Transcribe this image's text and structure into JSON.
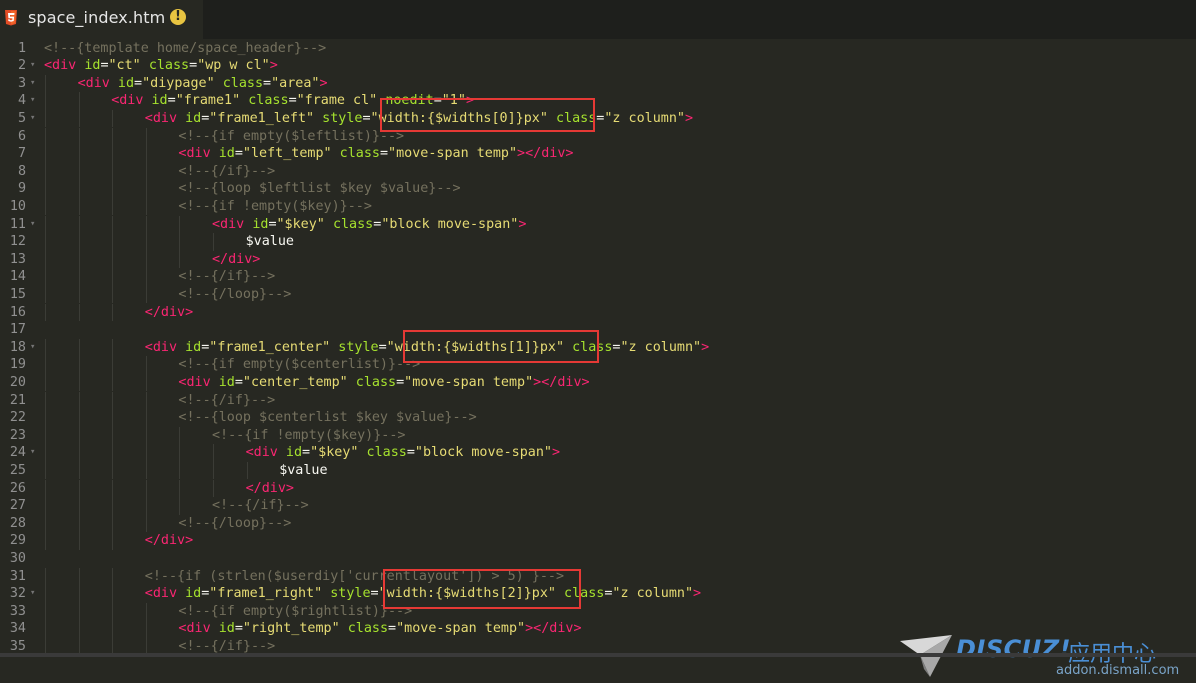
{
  "tab": {
    "title": "space_index.htm",
    "file_icon": "html5-icon",
    "status_icon": "warning-icon",
    "status_glyph": "!"
  },
  "lines": [
    {
      "n": "1",
      "fold": false,
      "ind": 0,
      "toks": [
        [
          "c",
          "<!--{template home/space_header}-->"
        ]
      ]
    },
    {
      "n": "2",
      "fold": true,
      "ind": 0,
      "toks": [
        [
          "t",
          "<div"
        ],
        [
          "p",
          " "
        ],
        [
          "a",
          "id"
        ],
        [
          "p",
          "="
        ],
        [
          "s",
          "\"ct\""
        ],
        [
          "p",
          " "
        ],
        [
          "a",
          "class"
        ],
        [
          "p",
          "="
        ],
        [
          "s",
          "\"wp w cl\""
        ],
        [
          "t",
          ">"
        ]
      ]
    },
    {
      "n": "3",
      "fold": true,
      "ind": 1,
      "toks": [
        [
          "t",
          "<div"
        ],
        [
          "p",
          " "
        ],
        [
          "a",
          "id"
        ],
        [
          "p",
          "="
        ],
        [
          "s",
          "\"diypage\""
        ],
        [
          "p",
          " "
        ],
        [
          "a",
          "class"
        ],
        [
          "p",
          "="
        ],
        [
          "s",
          "\"area\""
        ],
        [
          "t",
          ">"
        ]
      ]
    },
    {
      "n": "4",
      "fold": true,
      "ind": 2,
      "toks": [
        [
          "t",
          "<div"
        ],
        [
          "p",
          " "
        ],
        [
          "a",
          "id"
        ],
        [
          "p",
          "="
        ],
        [
          "s",
          "\"frame1\""
        ],
        [
          "p",
          " "
        ],
        [
          "a",
          "class"
        ],
        [
          "p",
          "="
        ],
        [
          "s",
          "\"frame cl\""
        ],
        [
          "p",
          " "
        ],
        [
          "a",
          "noedit"
        ],
        [
          "p",
          "="
        ],
        [
          "s",
          "\"1\""
        ],
        [
          "t",
          ">"
        ]
      ]
    },
    {
      "n": "5",
      "fold": true,
      "ind": 3,
      "toks": [
        [
          "t",
          "<div"
        ],
        [
          "p",
          " "
        ],
        [
          "a",
          "id"
        ],
        [
          "p",
          "="
        ],
        [
          "s",
          "\"frame1_left\""
        ],
        [
          "p",
          " "
        ],
        [
          "a",
          "style"
        ],
        [
          "p",
          "="
        ],
        [
          "s",
          "\"width:{$widths[0]}px\""
        ],
        [
          "p",
          " "
        ],
        [
          "a",
          "class"
        ],
        [
          "p",
          "="
        ],
        [
          "s",
          "\"z column\""
        ],
        [
          "t",
          ">"
        ]
      ]
    },
    {
      "n": "6",
      "fold": false,
      "ind": 4,
      "toks": [
        [
          "c",
          "<!--{if empty($leftlist)}-->"
        ]
      ]
    },
    {
      "n": "7",
      "fold": false,
      "ind": 4,
      "toks": [
        [
          "t",
          "<div"
        ],
        [
          "p",
          " "
        ],
        [
          "a",
          "id"
        ],
        [
          "p",
          "="
        ],
        [
          "s",
          "\"left_temp\""
        ],
        [
          "p",
          " "
        ],
        [
          "a",
          "class"
        ],
        [
          "p",
          "="
        ],
        [
          "s",
          "\"move-span temp\""
        ],
        [
          "t",
          "></div>"
        ]
      ]
    },
    {
      "n": "8",
      "fold": false,
      "ind": 4,
      "toks": [
        [
          "c",
          "<!--{/if}-->"
        ]
      ]
    },
    {
      "n": "9",
      "fold": false,
      "ind": 4,
      "toks": [
        [
          "c",
          "<!--{loop $leftlist $key $value}-->"
        ]
      ]
    },
    {
      "n": "10",
      "fold": false,
      "ind": 4,
      "toks": [
        [
          "c",
          "<!--{if !empty($key)}-->"
        ]
      ]
    },
    {
      "n": "11",
      "fold": true,
      "ind": 5,
      "toks": [
        [
          "t",
          "<div"
        ],
        [
          "p",
          " "
        ],
        [
          "a",
          "id"
        ],
        [
          "p",
          "="
        ],
        [
          "s",
          "\"$key\""
        ],
        [
          "p",
          " "
        ],
        [
          "a",
          "class"
        ],
        [
          "p",
          "="
        ],
        [
          "s",
          "\"block move-span\""
        ],
        [
          "t",
          ">"
        ]
      ]
    },
    {
      "n": "12",
      "fold": false,
      "ind": 6,
      "toks": [
        [
          "p",
          "$value"
        ]
      ]
    },
    {
      "n": "13",
      "fold": false,
      "ind": 5,
      "toks": [
        [
          "t",
          "</div>"
        ]
      ]
    },
    {
      "n": "14",
      "fold": false,
      "ind": 4,
      "toks": [
        [
          "c",
          "<!--{/if}-->"
        ]
      ]
    },
    {
      "n": "15",
      "fold": false,
      "ind": 4,
      "toks": [
        [
          "c",
          "<!--{/loop}-->"
        ]
      ]
    },
    {
      "n": "16",
      "fold": false,
      "ind": 3,
      "toks": [
        [
          "t",
          "</div>"
        ]
      ]
    },
    {
      "n": "17",
      "fold": false,
      "ind": 0,
      "toks": []
    },
    {
      "n": "18",
      "fold": true,
      "ind": 3,
      "toks": [
        [
          "t",
          "<div"
        ],
        [
          "p",
          " "
        ],
        [
          "a",
          "id"
        ],
        [
          "p",
          "="
        ],
        [
          "s",
          "\"frame1_center\""
        ],
        [
          "p",
          " "
        ],
        [
          "a",
          "style"
        ],
        [
          "p",
          "="
        ],
        [
          "s",
          "\"width:{$widths[1]}px\""
        ],
        [
          "p",
          " "
        ],
        [
          "a",
          "class"
        ],
        [
          "p",
          "="
        ],
        [
          "s",
          "\"z column\""
        ],
        [
          "t",
          ">"
        ]
      ]
    },
    {
      "n": "19",
      "fold": false,
      "ind": 4,
      "toks": [
        [
          "c",
          "<!--{if empty($centerlist)}-->"
        ]
      ]
    },
    {
      "n": "20",
      "fold": false,
      "ind": 4,
      "toks": [
        [
          "t",
          "<div"
        ],
        [
          "p",
          " "
        ],
        [
          "a",
          "id"
        ],
        [
          "p",
          "="
        ],
        [
          "s",
          "\"center_temp\""
        ],
        [
          "p",
          " "
        ],
        [
          "a",
          "class"
        ],
        [
          "p",
          "="
        ],
        [
          "s",
          "\"move-span temp\""
        ],
        [
          "t",
          "></div>"
        ]
      ]
    },
    {
      "n": "21",
      "fold": false,
      "ind": 4,
      "toks": [
        [
          "c",
          "<!--{/if}-->"
        ]
      ]
    },
    {
      "n": "22",
      "fold": false,
      "ind": 4,
      "toks": [
        [
          "c",
          "<!--{loop $centerlist $key $value}-->"
        ]
      ]
    },
    {
      "n": "23",
      "fold": false,
      "ind": 5,
      "toks": [
        [
          "c",
          "<!--{if !empty($key)}-->"
        ]
      ]
    },
    {
      "n": "24",
      "fold": true,
      "ind": 6,
      "toks": [
        [
          "t",
          "<div"
        ],
        [
          "p",
          " "
        ],
        [
          "a",
          "id"
        ],
        [
          "p",
          "="
        ],
        [
          "s",
          "\"$key\""
        ],
        [
          "p",
          " "
        ],
        [
          "a",
          "class"
        ],
        [
          "p",
          "="
        ],
        [
          "s",
          "\"block move-span\""
        ],
        [
          "t",
          ">"
        ]
      ]
    },
    {
      "n": "25",
      "fold": false,
      "ind": 7,
      "toks": [
        [
          "p",
          "$value"
        ]
      ]
    },
    {
      "n": "26",
      "fold": false,
      "ind": 6,
      "toks": [
        [
          "t",
          "</div>"
        ]
      ]
    },
    {
      "n": "27",
      "fold": false,
      "ind": 5,
      "toks": [
        [
          "c",
          "<!--{/if}-->"
        ]
      ]
    },
    {
      "n": "28",
      "fold": false,
      "ind": 4,
      "toks": [
        [
          "c",
          "<!--{/loop}-->"
        ]
      ]
    },
    {
      "n": "29",
      "fold": false,
      "ind": 3,
      "toks": [
        [
          "t",
          "</div>"
        ]
      ]
    },
    {
      "n": "30",
      "fold": false,
      "ind": 0,
      "toks": []
    },
    {
      "n": "31",
      "fold": false,
      "ind": 3,
      "toks": [
        [
          "c",
          "<!--{if (strlen($userdiy['currentlayout']) > 5) }-->"
        ]
      ]
    },
    {
      "n": "32",
      "fold": true,
      "ind": 3,
      "toks": [
        [
          "t",
          "<div"
        ],
        [
          "p",
          " "
        ],
        [
          "a",
          "id"
        ],
        [
          "p",
          "="
        ],
        [
          "s",
          "\"frame1_right\""
        ],
        [
          "p",
          " "
        ],
        [
          "a",
          "style"
        ],
        [
          "p",
          "="
        ],
        [
          "s",
          "\"width:{$widths[2]}px\""
        ],
        [
          "p",
          " "
        ],
        [
          "a",
          "class"
        ],
        [
          "p",
          "="
        ],
        [
          "s",
          "\"z column\""
        ],
        [
          "t",
          ">"
        ]
      ]
    },
    {
      "n": "33",
      "fold": false,
      "ind": 4,
      "toks": [
        [
          "c",
          "<!--{if empty($rightlist)}-->"
        ]
      ]
    },
    {
      "n": "34",
      "fold": false,
      "ind": 4,
      "toks": [
        [
          "t",
          "<div"
        ],
        [
          "p",
          " "
        ],
        [
          "a",
          "id"
        ],
        [
          "p",
          "="
        ],
        [
          "s",
          "\"right_temp\""
        ],
        [
          "p",
          " "
        ],
        [
          "a",
          "class"
        ],
        [
          "p",
          "="
        ],
        [
          "s",
          "\"move-span temp\""
        ],
        [
          "t",
          "></div>"
        ]
      ]
    },
    {
      "n": "35",
      "fold": false,
      "ind": 4,
      "toks": [
        [
          "c",
          "<!--{/if}-->"
        ]
      ]
    }
  ],
  "highlights": [
    {
      "label": "width:{$widths[0]}px",
      "line": "5"
    },
    {
      "label": "width:{$widths[1]}px",
      "line": "18"
    },
    {
      "label": "width:{$widths[2]}px",
      "line": "32"
    }
  ],
  "watermark": {
    "brand": "DISCUZ!",
    "cn": "应用中心",
    "url": "addon.dismall.com"
  },
  "theme": {
    "tag": "#f92672",
    "attr": "#a6e22e",
    "string": "#e6db74",
    "comment": "#75715e",
    "highlight_box": "#e53935",
    "watermark": "#4a8fd6"
  }
}
